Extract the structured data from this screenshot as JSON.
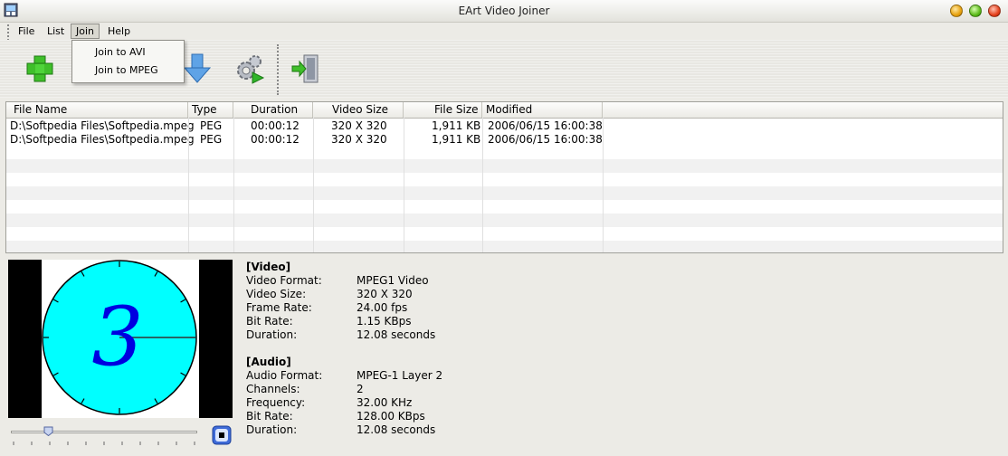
{
  "window": {
    "title": "EArt Video Joiner"
  },
  "menu": {
    "items": [
      "File",
      "List",
      "Join",
      "Help"
    ],
    "active": "Join"
  },
  "join_menu": {
    "items": [
      "Join to AVI",
      "Join to MPEG"
    ]
  },
  "toolbar": {
    "buttons": [
      "add-icon",
      "move-down-icon",
      "settings-run-icon",
      "exit-icon"
    ]
  },
  "file_list": {
    "columns": [
      "File Name",
      "Type",
      "Duration",
      "Video Size",
      "File Size",
      "Modified"
    ],
    "rows": [
      [
        "D:\\Softpedia Files\\Softpedia.mpeg",
        "PEG",
        "00:00:12",
        "320 X 320",
        "1,911 KB",
        "2006/06/15 16:00:38"
      ],
      [
        "D:\\Softpedia Files\\Softpedia.mpeg",
        "PEG",
        "00:00:12",
        "320 X 320",
        "1,911 KB",
        "2006/06/15 16:00:38"
      ]
    ]
  },
  "preview": {
    "digit": "3",
    "face_color": "#00ffff",
    "digit_color": "#0000e0"
  },
  "info": {
    "video_heading": "[Video]",
    "video": [
      {
        "label": "Video Format:",
        "value": "MPEG1 Video"
      },
      {
        "label": "Video Size:",
        "value": "320 X 320"
      },
      {
        "label": "Frame Rate:",
        "value": "24.00 fps"
      },
      {
        "label": "Bit Rate:",
        "value": "1.15 KBps"
      },
      {
        "label": "Duration:",
        "value": "12.08 seconds"
      }
    ],
    "audio_heading": "[Audio]",
    "audio": [
      {
        "label": "Audio Format:",
        "value": "MPEG-1 Layer 2"
      },
      {
        "label": "Channels:",
        "value": "2"
      },
      {
        "label": "Frequency:",
        "value": "32.00 KHz"
      },
      {
        "label": "Bit Rate:",
        "value": "128.00 KBps"
      },
      {
        "label": "Duration:",
        "value": "12.08 seconds"
      }
    ]
  },
  "playback": {
    "position_fraction": 0.2
  }
}
